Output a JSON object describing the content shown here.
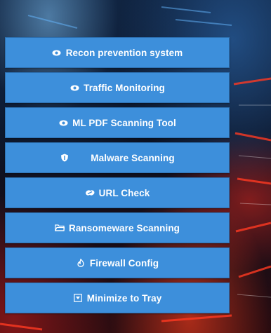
{
  "menu": {
    "items": [
      {
        "label": "Recon prevention system",
        "icon": "eye-icon"
      },
      {
        "label": "Traffic Monitoring",
        "icon": "eye-icon"
      },
      {
        "label": "ML PDF Scanning Tool",
        "icon": "eye-icon"
      },
      {
        "label": "Malware Scanning",
        "icon": "shield-icon"
      },
      {
        "label": "URL Check",
        "icon": "link-icon"
      },
      {
        "label": "Ransomeware Scanning",
        "icon": "folder-icon"
      },
      {
        "label": "Firewall Config",
        "icon": "fire-icon"
      },
      {
        "label": "Minimize to Tray",
        "icon": "minimize-icon"
      }
    ]
  },
  "colors": {
    "button_bg": "#3d8fdb",
    "button_border": "#2c6fb0",
    "button_text": "#ffffff"
  }
}
